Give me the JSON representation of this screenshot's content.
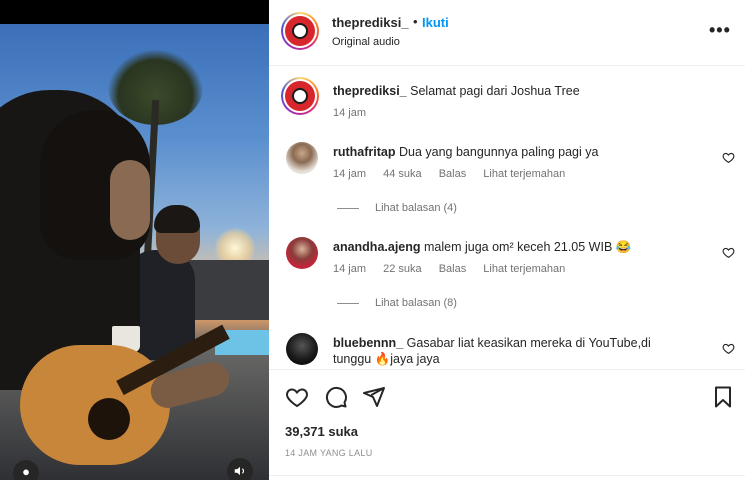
{
  "header": {
    "username": "theprediksi_",
    "dot": "•",
    "follow_label": "Ikuti",
    "audio_label": "Original audio",
    "more_icon": "more-horizontal-icon"
  },
  "caption": {
    "username": "theprediksi_",
    "text": "Selamat pagi dari Joshua Tree",
    "time": "14 jam"
  },
  "comments": [
    {
      "username": "ruthafritap",
      "text": "Dua yang bangunnya paling pagi ya",
      "time": "14 jam",
      "likes": "44 suka",
      "reply_label": "Balas",
      "translate_label": "Lihat terjemahan",
      "view_replies": "Lihat balasan (4)"
    },
    {
      "username": "anandha.ajeng",
      "text": "malem juga om² keceh 21.05 WIB 😂",
      "time": "14 jam",
      "likes": "22 suka",
      "reply_label": "Balas",
      "translate_label": "Lihat terjemahan",
      "view_replies": "Lihat balasan (8)"
    },
    {
      "username": "bluebennn_",
      "text_line1": "Gasabar liat keasikan mereka di YouTube,di",
      "text_line2": "tunggu 🔥jaya jaya"
    }
  ],
  "footer": {
    "likes": "39,371 suka",
    "time_ago": "14 JAM YANG LALU"
  },
  "colors": {
    "accent": "#0095f6",
    "text": "#262626",
    "muted": "#737373",
    "brand_red": "#d7262c"
  }
}
